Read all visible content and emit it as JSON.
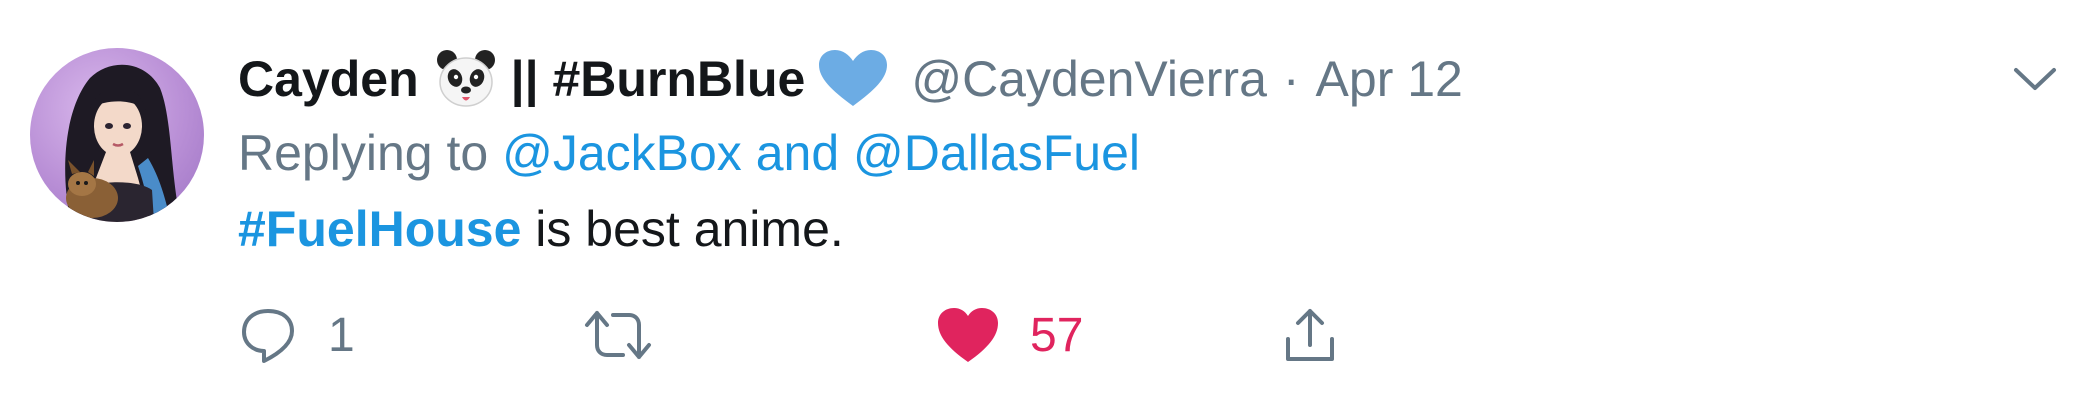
{
  "tweet": {
    "display_name_part1": "Cayden",
    "display_name_part2": "|| #BurnBlue",
    "handle": "@CaydenVierra",
    "separator": "·",
    "date": "Apr 12",
    "reply_prefix": "Replying to",
    "reply_mention_1": "@JackBox",
    "reply_and": "and",
    "reply_mention_2": "@DallasFuel",
    "text_hashtag": "#FuelHouse",
    "text_rest": " is best anime.",
    "emoji_1": "panda-face-emoji",
    "emoji_2": "blue-heart-emoji"
  },
  "actions": {
    "reply_count": "1",
    "retweet_count": "",
    "like_count": "57",
    "icons": [
      "reply-icon",
      "retweet-icon",
      "like-icon",
      "share-icon"
    ]
  },
  "colors": {
    "text_primary": "#14171a",
    "text_secondary": "#657786",
    "link": "#1b95e0",
    "like": "#e0245e",
    "blue_heart": "#6cace4"
  }
}
